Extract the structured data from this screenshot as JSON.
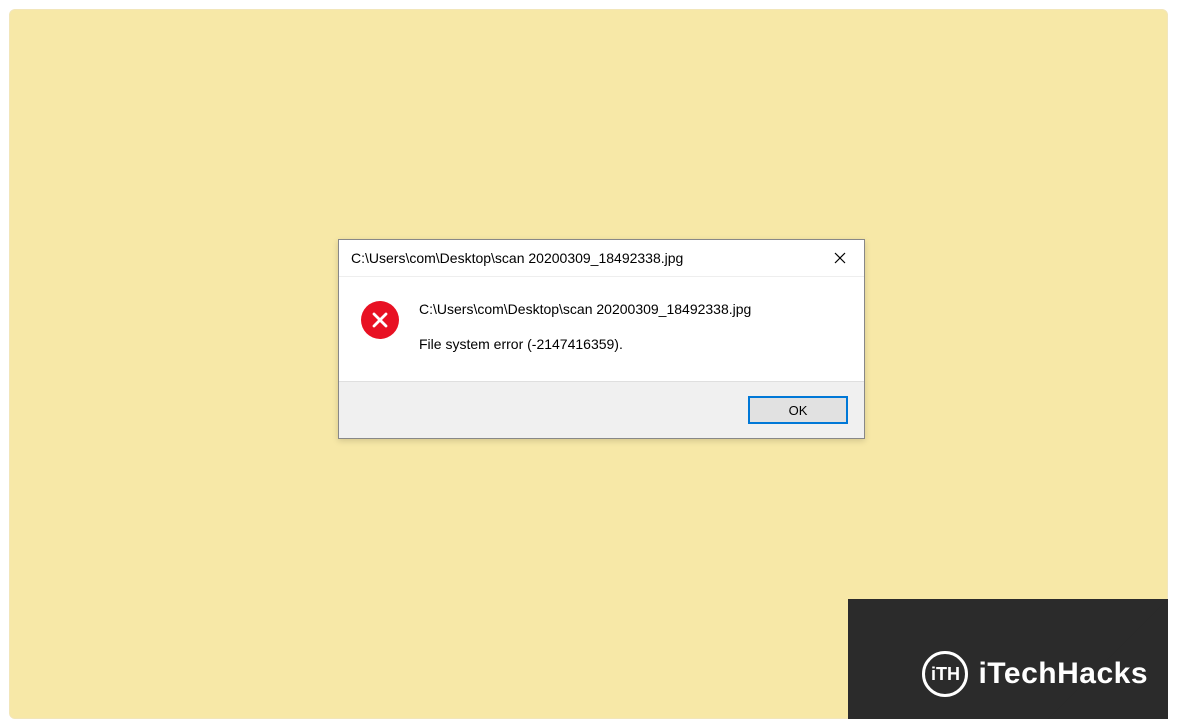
{
  "dialog": {
    "title": "C:\\Users\\com\\Desktop\\scan 20200309_18492338.jpg",
    "message_path": "C:\\Users\\com\\Desktop\\scan 20200309_18492338.jpg",
    "error_text": "File system error (-2147416359).",
    "ok_label": "OK",
    "icons": {
      "error": "error-x-icon",
      "close": "close-icon"
    }
  },
  "watermark": {
    "logo_text": "iTH",
    "brand": "iTechHacks"
  }
}
